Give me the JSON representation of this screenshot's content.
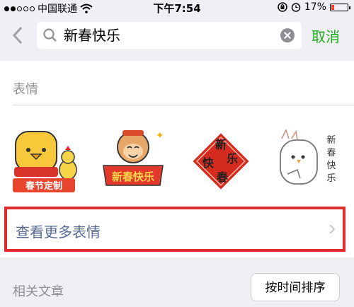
{
  "status_bar": {
    "carrier": "中国联通",
    "time": "下午7:54",
    "battery_text": "17%",
    "battery_level": 0.17,
    "signal_bars_filled": 2,
    "signal_bars_total": 5
  },
  "search": {
    "query": "新春快乐",
    "cancel_label": "取消",
    "accent_color": "#1aad19"
  },
  "stickers_section": {
    "label": "表情",
    "stickers": [
      {
        "name": "chick-sticker",
        "caption": "春节定制"
      },
      {
        "name": "monkey-sticker",
        "caption": "新春快乐"
      },
      {
        "name": "fu-sticker",
        "chars": [
          "新",
          "快",
          "乐",
          "春"
        ]
      },
      {
        "name": "bird-sticker",
        "chars": [
          "新",
          "春",
          "快",
          "乐"
        ]
      }
    ]
  },
  "more_emoji": {
    "label": "查看更多表情",
    "highlight_color": "#e02c2c"
  },
  "related_articles": {
    "label": "相关文章",
    "sort_button": "按时间排序"
  }
}
